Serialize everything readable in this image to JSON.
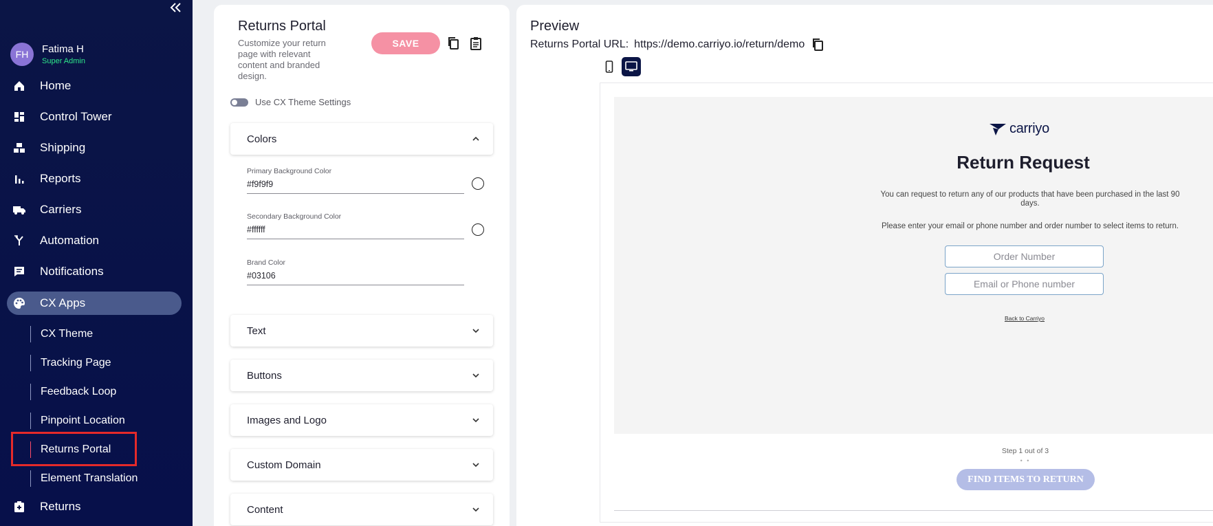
{
  "sidebar": {
    "user": {
      "initials": "FH",
      "name": "Fatima H",
      "role": "Super Admin"
    },
    "items": [
      {
        "label": "Home",
        "icon": "home-icon"
      },
      {
        "label": "Control Tower",
        "icon": "dashboard-icon"
      },
      {
        "label": "Shipping",
        "icon": "boxes-icon"
      },
      {
        "label": "Reports",
        "icon": "bar-chart-icon"
      },
      {
        "label": "Carriers",
        "icon": "truck-icon"
      },
      {
        "label": "Automation",
        "icon": "automation-icon"
      },
      {
        "label": "Notifications",
        "icon": "message-icon"
      },
      {
        "label": "CX Apps",
        "icon": "palette-icon"
      },
      {
        "label": "Returns",
        "icon": "returns-icon"
      }
    ],
    "sub_items": [
      {
        "label": "CX Theme"
      },
      {
        "label": "Tracking Page"
      },
      {
        "label": "Feedback Loop"
      },
      {
        "label": "Pinpoint Location"
      },
      {
        "label": "Returns Portal"
      },
      {
        "label": "Element Translation"
      }
    ],
    "active_item": "CX Apps",
    "current_sub_item": "Returns Portal"
  },
  "settings": {
    "title": "Returns Portal",
    "description": "Customize your return page with relevant content and branded design.",
    "save_label": "SAVE",
    "toggle_label": "Use CX Theme Settings",
    "sections": [
      {
        "label": "Colors",
        "expanded": true
      },
      {
        "label": "Text"
      },
      {
        "label": "Buttons"
      },
      {
        "label": "Images and Logo"
      },
      {
        "label": "Custom Domain"
      },
      {
        "label": "Content"
      }
    ],
    "colors": {
      "primary_label": "Primary Background Color",
      "primary_value": "#f9f9f9",
      "secondary_label": "Secondary Background Color",
      "secondary_value": "#ffffff",
      "brand_label": "Brand Color",
      "brand_value": "#03106"
    }
  },
  "preview": {
    "title": "Preview",
    "url_label": "Returns Portal URL:",
    "url_value": "https://demo.carriyo.io/return/demo",
    "portal": {
      "logo_text": "carriyo",
      "title": "Return Request",
      "text1": "You can request to return any of our products that have been purchased in the last 90 days.",
      "text2": "Please enter your email or phone number and order number to select items to return.",
      "order_placeholder": "Order Number",
      "email_placeholder": "Email or Phone number",
      "back_link": "Back to Carriyo",
      "step_text": "Step 1 out of 3",
      "button_label": "FIND ITEMS TO RETURN"
    }
  },
  "colors": {
    "sidebar_bg": "#0b1546",
    "accent_pink": "#f591a4",
    "active_nav": "#4a5a8c",
    "highlight_red": "#e52a2a",
    "role_green": "#2ee88a"
  }
}
